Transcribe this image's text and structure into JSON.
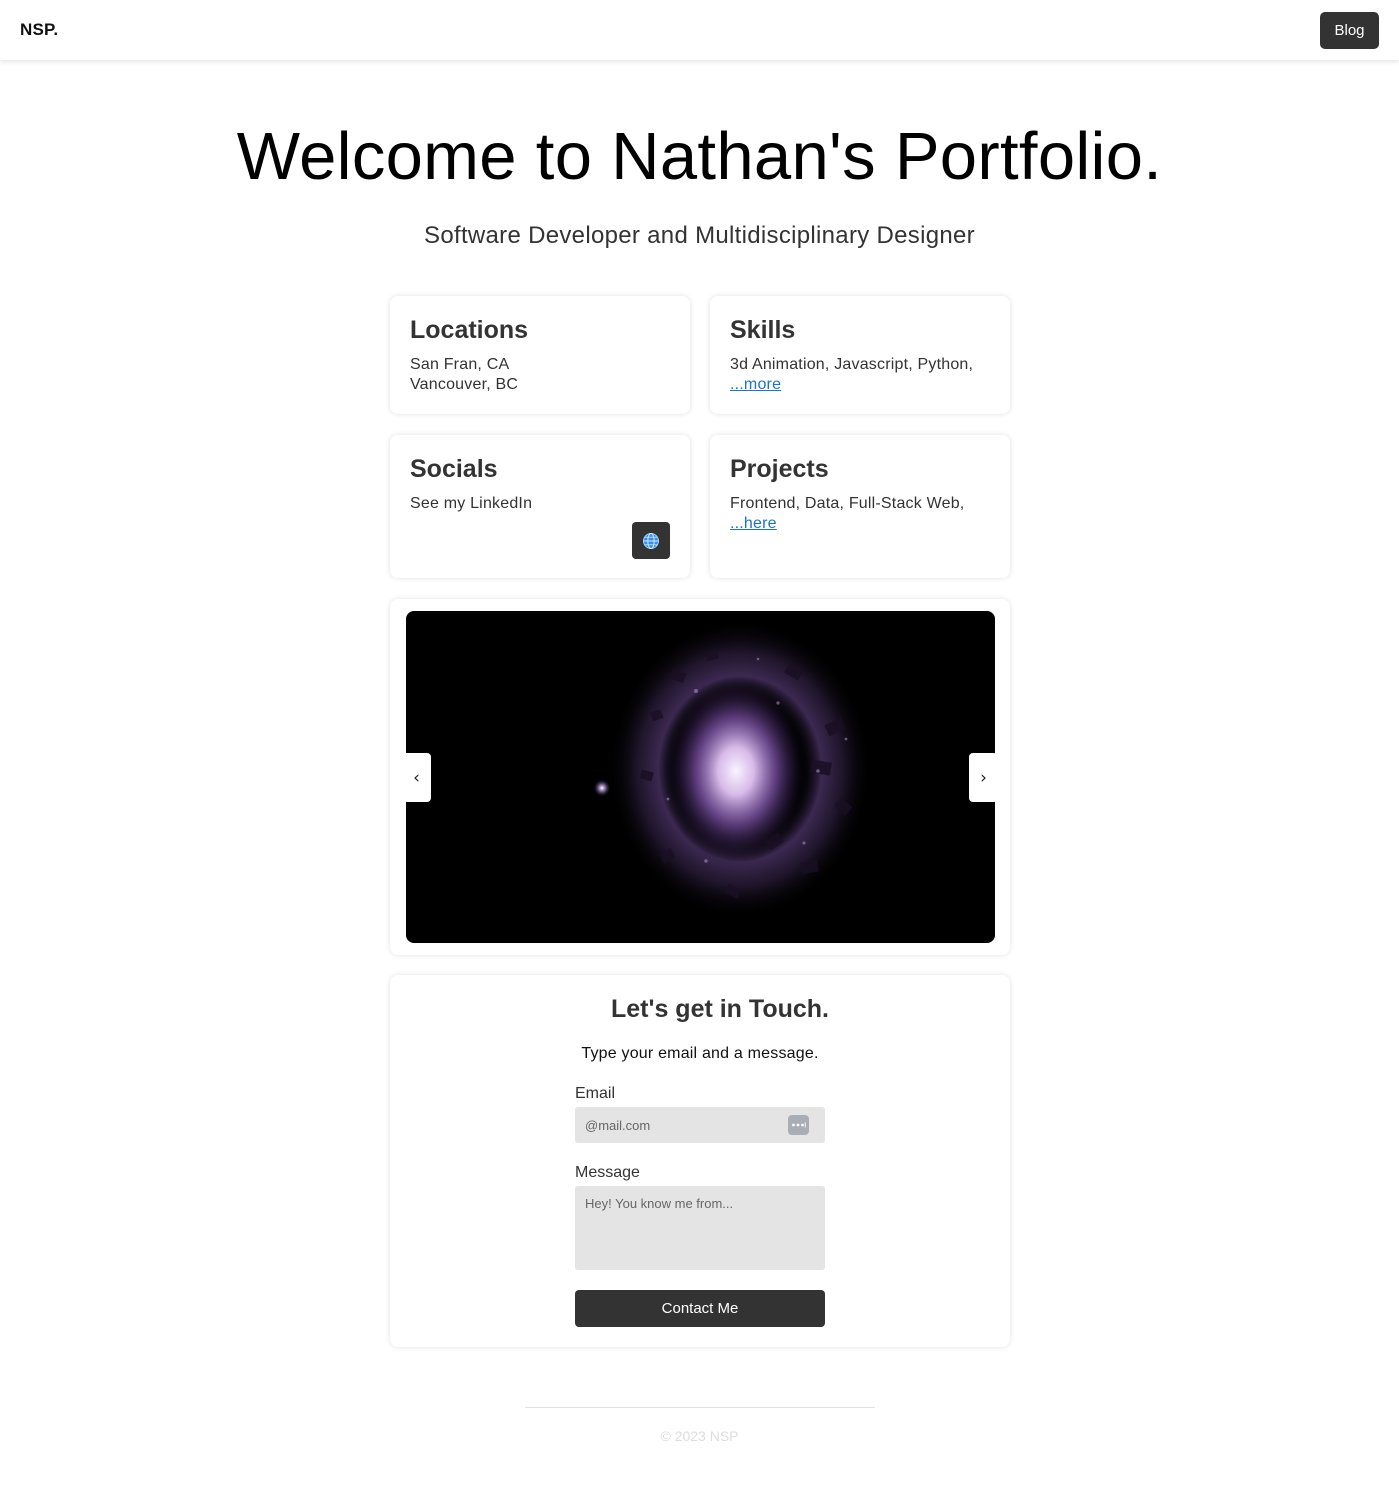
{
  "header": {
    "brand": "NSP.",
    "blog_label": "Blog"
  },
  "hero": {
    "title": "Welcome to Nathan's Portfolio.",
    "subtitle": "Software Developer and Multidisciplinary Designer"
  },
  "cards": {
    "locations": {
      "title": "Locations",
      "lines": [
        "San Fran, CA",
        "Vancouver, BC"
      ]
    },
    "skills": {
      "title": "Skills",
      "text": "3d Animation, Javascript, Python,",
      "link": "...more"
    },
    "socials": {
      "title": "Socials",
      "text": "See my LinkedIn",
      "icon": "globe-icon"
    },
    "projects": {
      "title": "Projects",
      "text": "Frontend, Data, Full-Stack Web,",
      "link": "...here"
    }
  },
  "carousel": {
    "prev": "‹",
    "next": "›"
  },
  "contact": {
    "title": "Let's get in Touch.",
    "subtitle": "Type your email and a message.",
    "email_label": "Email",
    "email_placeholder": "@mail.com",
    "message_label": "Message",
    "message_placeholder": "Hey! You know me from...",
    "button": "Contact Me"
  },
  "footer": {
    "text": "© 2023 NSP"
  },
  "colors": {
    "accent_dark": "#333333",
    "link": "#1a73c9",
    "glow": "#c9a6f0"
  }
}
